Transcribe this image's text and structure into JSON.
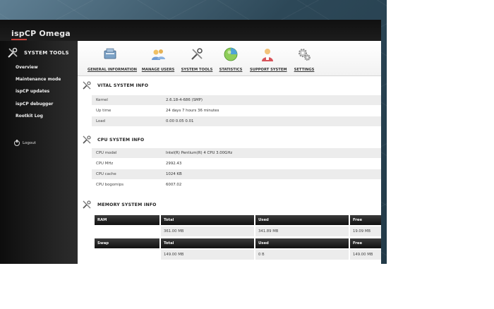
{
  "app": {
    "logo": "ispCP Omega"
  },
  "sidebar": {
    "section_title": "System tools",
    "items": [
      {
        "label": "Overview"
      },
      {
        "label": "Maintenance mode"
      },
      {
        "label": "ispCP updates"
      },
      {
        "label": "ispCP debugger"
      },
      {
        "label": "Rootkit Log"
      }
    ],
    "logout_label": "Logout"
  },
  "nav": {
    "items": [
      {
        "label": "General information",
        "icon": "general-info-icon"
      },
      {
        "label": "Manage users",
        "icon": "manage-users-icon"
      },
      {
        "label": "System tools",
        "icon": "system-tools-icon"
      },
      {
        "label": "Statistics",
        "icon": "statistics-icon"
      },
      {
        "label": "Support system",
        "icon": "support-system-icon"
      },
      {
        "label": "Settings",
        "icon": "settings-icon"
      }
    ]
  },
  "vital": {
    "title": "Vital system info",
    "rows": [
      {
        "key": "Kernel",
        "value": "2.6.18-4-686 (SMP)"
      },
      {
        "key": "Up time",
        "value": "24 days 7 hours 36 minutes"
      },
      {
        "key": "Load",
        "value": "0.00 0.05 0.01"
      }
    ]
  },
  "cpu": {
    "title": "CPU system info",
    "rows": [
      {
        "key": "CPU model",
        "value": "Intel(R) Pentium(R) 4 CPU 3.00GHz"
      },
      {
        "key": "CPU MHz",
        "value": "2992.43"
      },
      {
        "key": "CPU cache",
        "value": "1024 KB"
      },
      {
        "key": "CPU bogomips",
        "value": "6007.02"
      }
    ]
  },
  "memory": {
    "title": "Memory system info",
    "ram": {
      "label": "RAM",
      "total_label": "Total",
      "used_label": "Used",
      "free_label": "Free",
      "total": "361.00 MB",
      "used": "341.89 MB",
      "free": "19.09 MB"
    },
    "swap": {
      "label": "Swap",
      "total_label": "Total",
      "used_label": "Used",
      "free_label": "Free",
      "total": "149.00 MB",
      "used": "0 B",
      "free": "149.00 MB"
    }
  },
  "colors": {
    "accent": "#c8423a",
    "header_dark": "#111111",
    "row_shade": "#ececec"
  }
}
